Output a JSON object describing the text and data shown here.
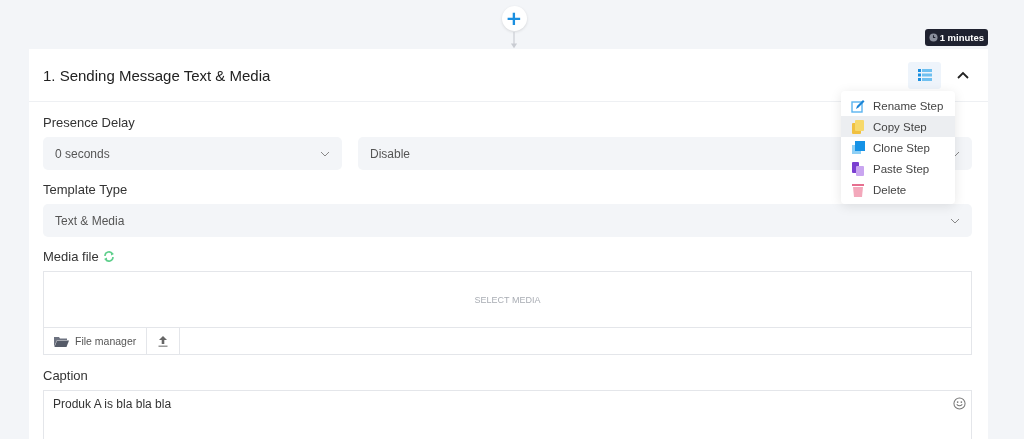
{
  "flow": {
    "add_button": "+",
    "duration": "1 minutes"
  },
  "step": {
    "title": "1. Sending Message Text & Media",
    "expanded": true,
    "menu": {
      "open": true,
      "items": [
        {
          "label": "Rename Step",
          "kind": "rename",
          "selected": false
        },
        {
          "label": "Copy Step",
          "kind": "copy",
          "selected": true
        },
        {
          "label": "Clone Step",
          "kind": "clone",
          "selected": false
        },
        {
          "label": "Paste Step",
          "kind": "paste",
          "selected": false
        },
        {
          "label": "Delete",
          "kind": "delete",
          "selected": false
        }
      ]
    },
    "presence_delay": {
      "label": "Presence Delay",
      "delay": "0 seconds",
      "mode": "Disable"
    },
    "template_type": {
      "label": "Template Type",
      "value": "Text & Media"
    },
    "media_file": {
      "label": "Media file",
      "placeholder": "SELECT MEDIA",
      "file_manager": "File manager"
    },
    "caption": {
      "label": "Caption",
      "value": "Produk A is bla bla bla"
    }
  }
}
